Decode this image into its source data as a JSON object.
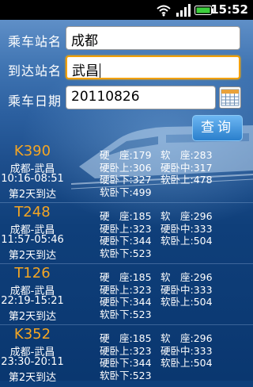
{
  "status_bar": {
    "time": "15:52"
  },
  "form": {
    "from_label": "乘车站名",
    "from_value": "成都",
    "to_label": "到达站名",
    "to_value": "武昌",
    "date_label": "乘车日期",
    "date_value": "20110826",
    "query_button": "查询"
  },
  "trains": [
    {
      "number": "K390",
      "route": "成都-武昌",
      "time": "10:16-08:51",
      "arrive": "第2天到达",
      "fares": [
        [
          "硬　座:179",
          "软　座:283"
        ],
        [
          "硬卧上:306",
          "硬卧中:317"
        ],
        [
          "硬卧下:327",
          "软卧上:478"
        ],
        [
          "软卧下:499",
          ""
        ]
      ]
    },
    {
      "number": "T248",
      "route": "成都-武昌",
      "time": "11:57-05:46",
      "arrive": "第2天到达",
      "fares": [
        [
          "硬　座:185",
          "软　座:296"
        ],
        [
          "硬卧上:323",
          "硬卧中:333"
        ],
        [
          "硬卧下:344",
          "软卧上:504"
        ],
        [
          "软卧下:523",
          ""
        ]
      ]
    },
    {
      "number": "T126",
      "route": "成都-武昌",
      "time": "22:19-15:21",
      "arrive": "第2天到达",
      "fares": [
        [
          "硬　座:185",
          "软　座:296"
        ],
        [
          "硬卧上:323",
          "硬卧中:333"
        ],
        [
          "硬卧下:344",
          "软卧上:504"
        ],
        [
          "软卧下:523",
          ""
        ]
      ]
    },
    {
      "number": "K352",
      "route": "成都-武昌",
      "time": "23:30-20:11",
      "arrive": "第2天到达",
      "fares": [
        [
          "硬　座:185",
          "软　座:296"
        ],
        [
          "硬卧上:323",
          "硬卧中:333"
        ],
        [
          "硬卧下:344",
          "软卧上:504"
        ],
        [
          "软卧下:523",
          ""
        ]
      ]
    }
  ],
  "colors": {
    "train_number": "#f5a623",
    "focus_border": "#f2a000"
  },
  "icons": [
    "wifi-icon",
    "signal-icon",
    "battery-icon",
    "calendar-icon"
  ]
}
